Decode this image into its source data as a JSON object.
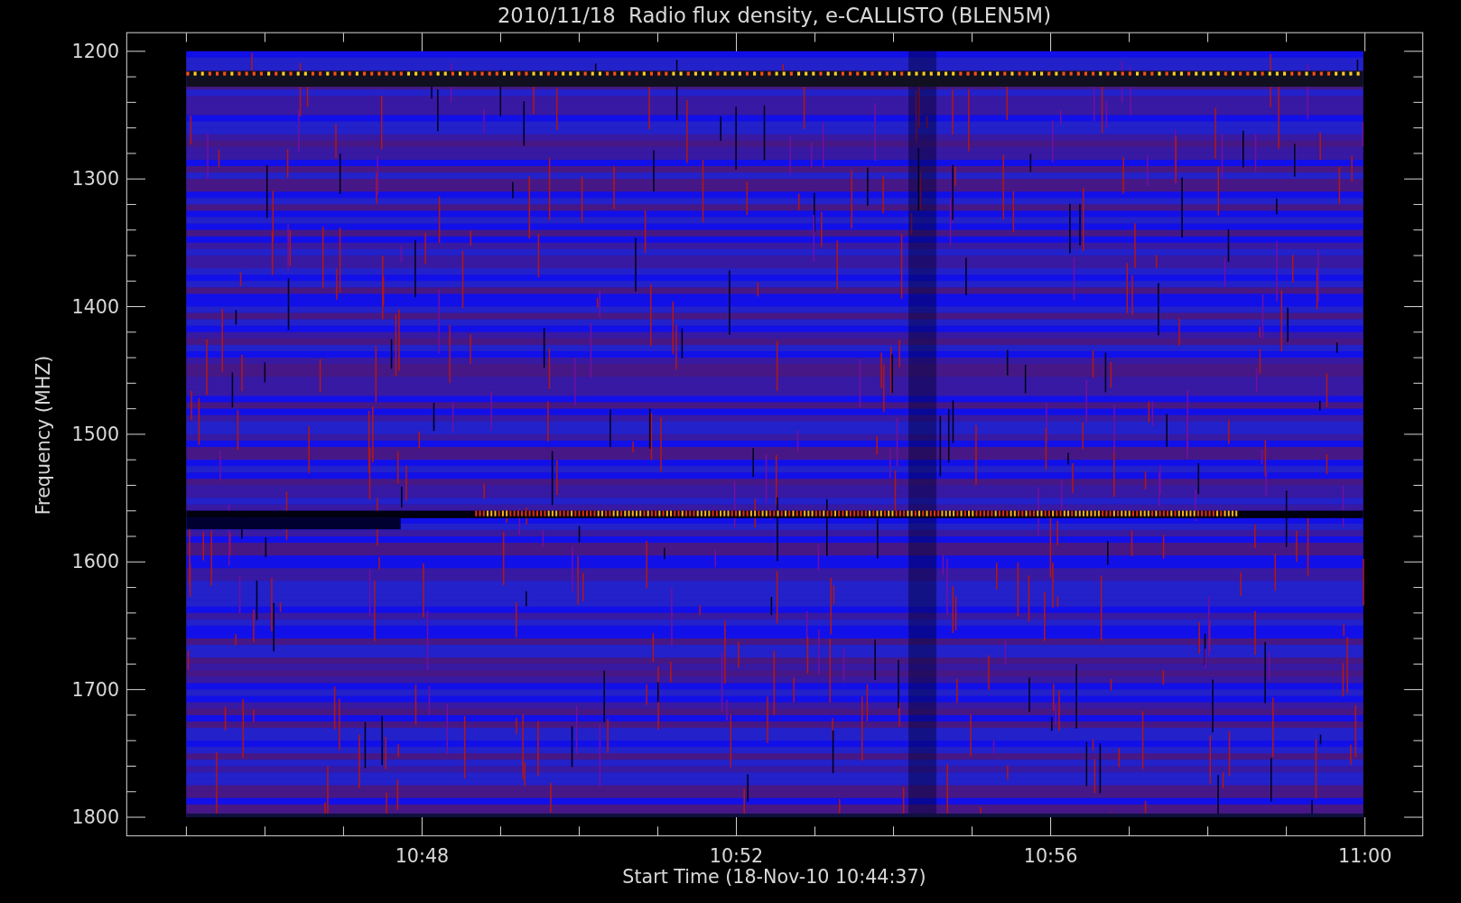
{
  "title": "2010/11/18  Radio flux density, e-CALLISTO (BLEN5M)",
  "y_axis": {
    "label": "Frequency (MHZ)",
    "ticks": [
      "1200",
      "1300",
      "1400",
      "1500",
      "1600",
      "1700",
      "1800"
    ]
  },
  "x_axis": {
    "label": "Start Time (18-Nov-10 10:44:37)",
    "ticks": [
      "10:48",
      "10:52",
      "10:56",
      "11:00"
    ]
  }
}
